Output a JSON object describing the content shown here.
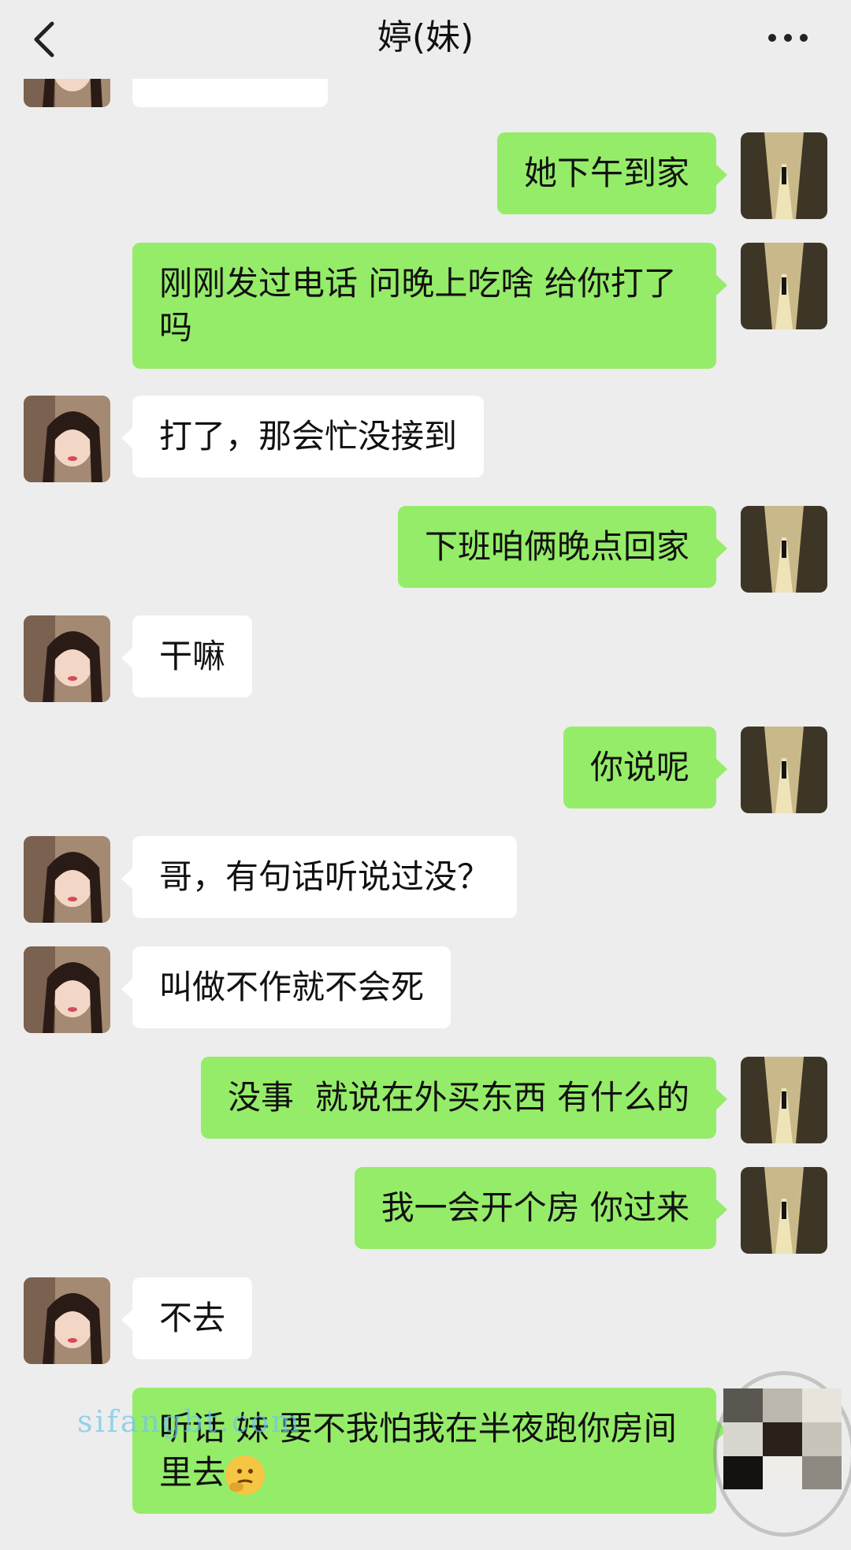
{
  "header": {
    "title": "婷(妹)",
    "back_icon": "chevron-left-icon",
    "more_icon": "more-dots-icon"
  },
  "messages": [
    {
      "side": "out",
      "text": "她下午到家"
    },
    {
      "side": "out",
      "text": "刚刚发过电话 问晚上吃啥 给你打了吗"
    },
    {
      "side": "in",
      "text": "打了，那会忙没接到"
    },
    {
      "side": "out",
      "text": "下班咱俩晚点回家"
    },
    {
      "side": "in",
      "text": "干嘛"
    },
    {
      "side": "out",
      "text": "你说呢"
    },
    {
      "side": "in",
      "text": "哥，有句话听说过没？"
    },
    {
      "side": "in",
      "text": "叫做不作就不会死"
    },
    {
      "side": "out",
      "text": "没事  就说在外买东西 有什么的"
    },
    {
      "side": "out",
      "text": "我一会开个房 你过来"
    },
    {
      "side": "in",
      "text": "不去"
    },
    {
      "side": "out",
      "text": "听话 妹 要不我怕我在半夜跑你房间里去",
      "emoji": "thinking-face-emoji"
    }
  ],
  "watermark": "sifangbt.com",
  "colors": {
    "background": "#ededed",
    "outgoing_bubble": "#95ec69",
    "incoming_bubble": "#ffffff"
  }
}
